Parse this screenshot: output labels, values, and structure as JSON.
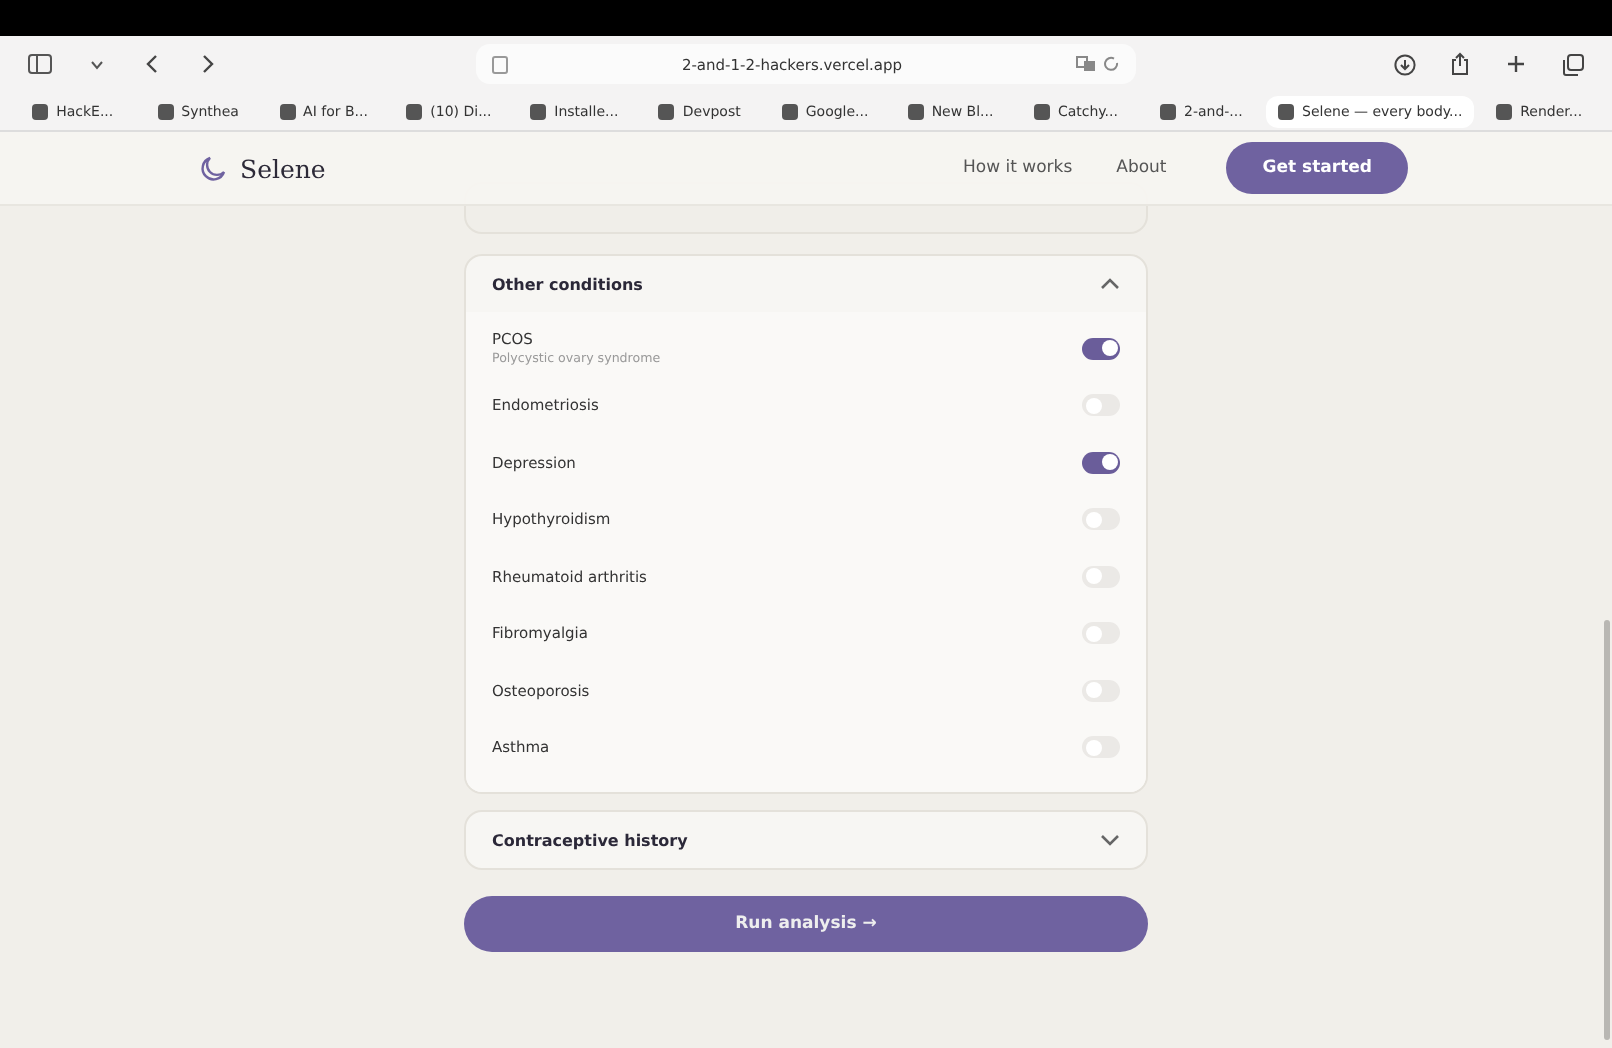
{
  "browser": {
    "address": "2-and-1-2-hackers.vercel.app",
    "bookmarks": [
      {
        "label": "HackE...",
        "selected": false
      },
      {
        "label": "Synthea",
        "selected": false
      },
      {
        "label": "AI for B...",
        "selected": false
      },
      {
        "label": "(10) Di...",
        "selected": false
      },
      {
        "label": "Installe...",
        "selected": false
      },
      {
        "label": "Devpost",
        "selected": false
      },
      {
        "label": "Google...",
        "selected": false
      },
      {
        "label": "New Bl...",
        "selected": false
      },
      {
        "label": "Catchy...",
        "selected": false
      },
      {
        "label": "2-and-...",
        "selected": false
      },
      {
        "label": "Selene — every body...",
        "selected": true
      },
      {
        "label": "Render...",
        "selected": false
      }
    ]
  },
  "header": {
    "brand": "Selene",
    "nav": [
      "How it works",
      "About"
    ],
    "cta": "Get started"
  },
  "sections": [
    {
      "title": "Other conditions",
      "expanded": true,
      "items": [
        {
          "name": "PCOS",
          "detail": "Polycystic ovary syndrome",
          "on": true
        },
        {
          "name": "Endometriosis",
          "on": false
        },
        {
          "name": "Depression",
          "on": true
        },
        {
          "name": "Hypothyroidism",
          "on": false
        },
        {
          "name": "Rheumatoid arthritis",
          "on": false
        },
        {
          "name": "Fibromyalgia",
          "on": false
        },
        {
          "name": "Osteoporosis",
          "on": false
        },
        {
          "name": "Asthma",
          "on": false
        }
      ]
    },
    {
      "title": "Contraceptive history",
      "expanded": false
    }
  ],
  "action": "Run analysis →"
}
